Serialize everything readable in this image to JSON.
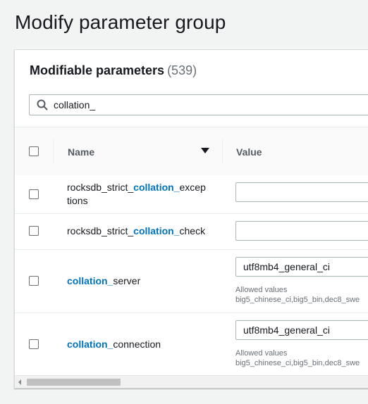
{
  "page": {
    "title": "Modify parameter group"
  },
  "panel": {
    "heading": "Modifiable parameters",
    "count": "(539)",
    "search": {
      "value": "collation_",
      "icon": "search-icon"
    }
  },
  "table": {
    "columns": {
      "name": "Name",
      "value": "Value"
    },
    "sort_icon": "caret-down-icon",
    "rows": [
      {
        "name_prefix": "rocksdb_strict_",
        "name_match": "collation_",
        "name_suffix": "excep",
        "name_suffix2": "tions",
        "value": "",
        "allowed_label": "",
        "allowed_values": ""
      },
      {
        "name_prefix": "rocksdb_strict_",
        "name_match": "collation_",
        "name_suffix": "check",
        "value": "",
        "allowed_label": "",
        "allowed_values": ""
      },
      {
        "name_prefix": "",
        "name_match": "collation_",
        "name_suffix": "server",
        "value": "utf8mb4_general_ci",
        "allowed_label": "Allowed values",
        "allowed_values": "big5_chinese_ci,big5_bin,dec8_swe"
      },
      {
        "name_prefix": "",
        "name_match": "collation_",
        "name_suffix": "connection",
        "value": "utf8mb4_general_ci",
        "allowed_label": "Allowed values",
        "allowed_values": "big5_chinese_ci,big5_bin,dec8_swe"
      }
    ]
  },
  "colors": {
    "link_highlight": "#0073bb",
    "background": "#f2f3f3",
    "panel": "#ffffff"
  }
}
